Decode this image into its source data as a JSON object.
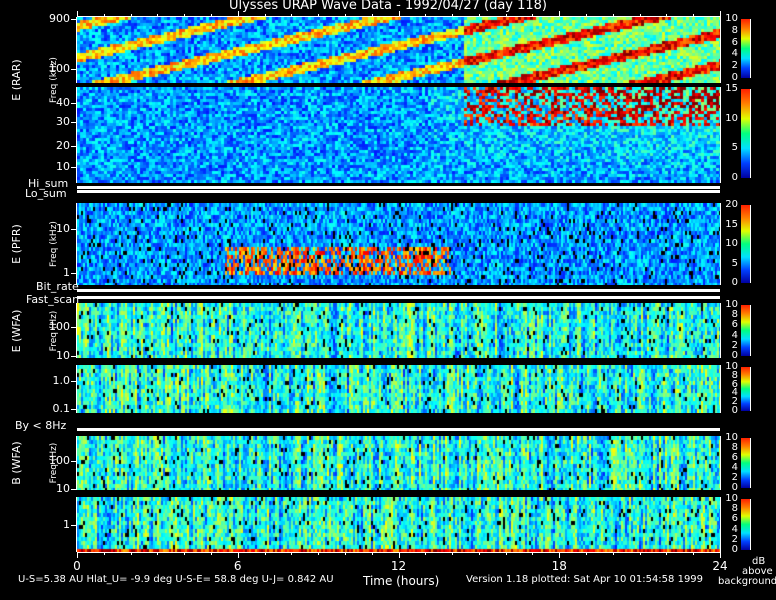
{
  "title": "Ulysses URAP Wave Data - 1992/04/27  (day 118)",
  "chart_data": {
    "type": "heatmap",
    "title": "Ulysses URAP Wave Data - 1992/04/27  (day 118)",
    "xlabel": "Time (hours)",
    "xlim": [
      0,
      24
    ],
    "x_ticks": [
      "0",
      "6",
      "12",
      "18",
      "24"
    ],
    "panels": [
      {
        "id": "rar-high",
        "label": "E (RAR)",
        "ylabel": "Freq (kHz)",
        "y_ticks": [
          "900",
          "100"
        ],
        "colorbar": {
          "range": [
            0,
            10
          ],
          "ticks": [
            "10",
            "8",
            "6",
            "4",
            "2",
            "0"
          ]
        }
      },
      {
        "id": "rar-low",
        "label": "",
        "ylabel": "",
        "y_ticks": [
          "40",
          "30",
          "20",
          "10"
        ],
        "colorbar": {
          "range": [
            0,
            15
          ],
          "ticks": [
            "15",
            "10",
            "5",
            "0"
          ]
        }
      },
      {
        "id": "pfr",
        "label": "E (PFR)",
        "ylabel": "Freq (kHz)",
        "y_ticks": [
          "10",
          "1"
        ],
        "colorbar": {
          "range": [
            0,
            20
          ],
          "ticks": [
            "20",
            "15",
            "10",
            "5",
            "0"
          ]
        }
      },
      {
        "id": "wfa-e-high",
        "label": "E (WFA)",
        "ylabel": "Freq (Hz)",
        "y_ticks": [
          "100",
          "10"
        ],
        "colorbar": {
          "range": [
            0,
            10
          ],
          "ticks": [
            "10",
            "8",
            "6",
            "4",
            "2",
            "0"
          ]
        }
      },
      {
        "id": "wfa-e-low",
        "label": "",
        "ylabel": "",
        "y_ticks": [
          "1.0",
          "0.1"
        ],
        "colorbar": {
          "range": [
            0,
            10
          ],
          "ticks": [
            "10",
            "8",
            "6",
            "4",
            "2",
            "0"
          ]
        }
      },
      {
        "id": "wfa-b-high",
        "label": "B (WFA)",
        "ylabel": "Freq (Hz)",
        "y_ticks": [
          "100",
          "10"
        ],
        "colorbar": {
          "range": [
            0,
            10
          ],
          "ticks": [
            "10",
            "8",
            "6",
            "4",
            "2",
            "0"
          ]
        }
      },
      {
        "id": "wfa-b-low",
        "label": "",
        "ylabel": "",
        "y_ticks": [
          "1"
        ],
        "colorbar": {
          "range": [
            0,
            10
          ],
          "ticks": [
            "10",
            "8",
            "6",
            "4",
            "2",
            "0"
          ]
        }
      }
    ],
    "status_bars": [
      "Hi_sum",
      "Lo_sum",
      "Bit_rate",
      "Fast_scan",
      "By < 8Hz"
    ],
    "colorbar_unit": "dB above background"
  },
  "labels": {
    "freq_khz": "Freq (kHz)",
    "freq_hz": "Freq (Hz)",
    "cb_unit_1": "dB",
    "cb_unit_2": "above",
    "cb_unit_3": "background"
  },
  "footer": {
    "orbit": "U-S=5.38 AU  Hlat_U= -9.9 deg  U-S-E= 58.8 deg  U-J= 0.842 AU",
    "version": "Version 1.18 plotted: Sat Apr 10 01:54:58 1999"
  }
}
